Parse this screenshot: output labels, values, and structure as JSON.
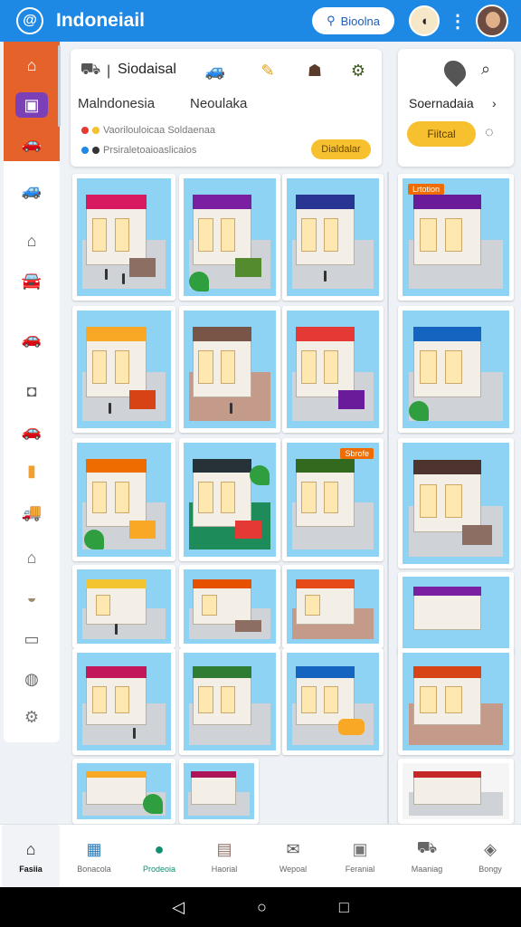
{
  "header": {
    "logo_glyph": "@",
    "title": "Indoneiail",
    "button_label": "Bioolna",
    "button_icon": "person-icon",
    "menu_glyph": "⋮",
    "colors": {
      "bar": "#1e88e5"
    }
  },
  "sidebar": {
    "active_color": "#e5632a",
    "items": [
      {
        "icon": "shop-icon",
        "glyph": "⌂"
      },
      {
        "icon": "tablet-icon",
        "glyph": "▣"
      },
      {
        "icon": "car-icon",
        "glyph": "🚗"
      },
      {
        "icon": "car-icon",
        "glyph": "🚙"
      },
      {
        "icon": "home-icon",
        "glyph": "⌂"
      },
      {
        "icon": "car-icon",
        "glyph": "🚘"
      },
      {
        "icon": "car-icon",
        "glyph": "🚗"
      },
      {
        "icon": "camera-icon",
        "glyph": "◘"
      },
      {
        "icon": "car-icon",
        "glyph": "🚗"
      },
      {
        "icon": "card-icon",
        "glyph": "▮"
      },
      {
        "icon": "truck-icon",
        "glyph": "🚚"
      },
      {
        "icon": "house-icon",
        "glyph": "⌂"
      },
      {
        "icon": "bowl-icon",
        "glyph": "◒"
      },
      {
        "icon": "document-icon",
        "glyph": "▭"
      },
      {
        "icon": "globe-icon",
        "glyph": "◍"
      },
      {
        "icon": "gear-icon",
        "glyph": "⚙"
      }
    ]
  },
  "top_panel": {
    "separator": "|",
    "title": "Siodaisal",
    "left_subtitle": "Malndonesia",
    "right_subtitle": "Neoulaka",
    "row1": "Vaorilouloicaa Soldaenaa",
    "row2": "Prsiraletoaioaslicaios",
    "button": "Dialdalar"
  },
  "right_panel": {
    "title": "Soernadaia",
    "chevron": "›",
    "button": "Fiitcal"
  },
  "grid": {
    "tags": [
      "Lrtotion",
      "Sbrofe"
    ]
  },
  "bottom_nav": {
    "items": [
      {
        "label": "Fasiia",
        "icon": "home-icon",
        "glyph": "⌂"
      },
      {
        "label": "Bonacola",
        "icon": "calendar-icon",
        "glyph": "▦"
      },
      {
        "label": "Prodeoia",
        "icon": "chat-icon",
        "glyph": "●"
      },
      {
        "label": "Haorial",
        "icon": "shop-icon",
        "glyph": "▤"
      },
      {
        "label": "Wepoal",
        "icon": "mail-icon",
        "glyph": "✉"
      },
      {
        "label": "Feranial",
        "icon": "receipt-icon",
        "glyph": "▣"
      },
      {
        "label": "Maaniag",
        "icon": "car-icon",
        "glyph": "⛟"
      },
      {
        "label": "Bongy",
        "icon": "tag-icon",
        "glyph": "◈"
      }
    ]
  },
  "system_bar": {
    "back": "◁",
    "home": "○",
    "recents": "□"
  }
}
